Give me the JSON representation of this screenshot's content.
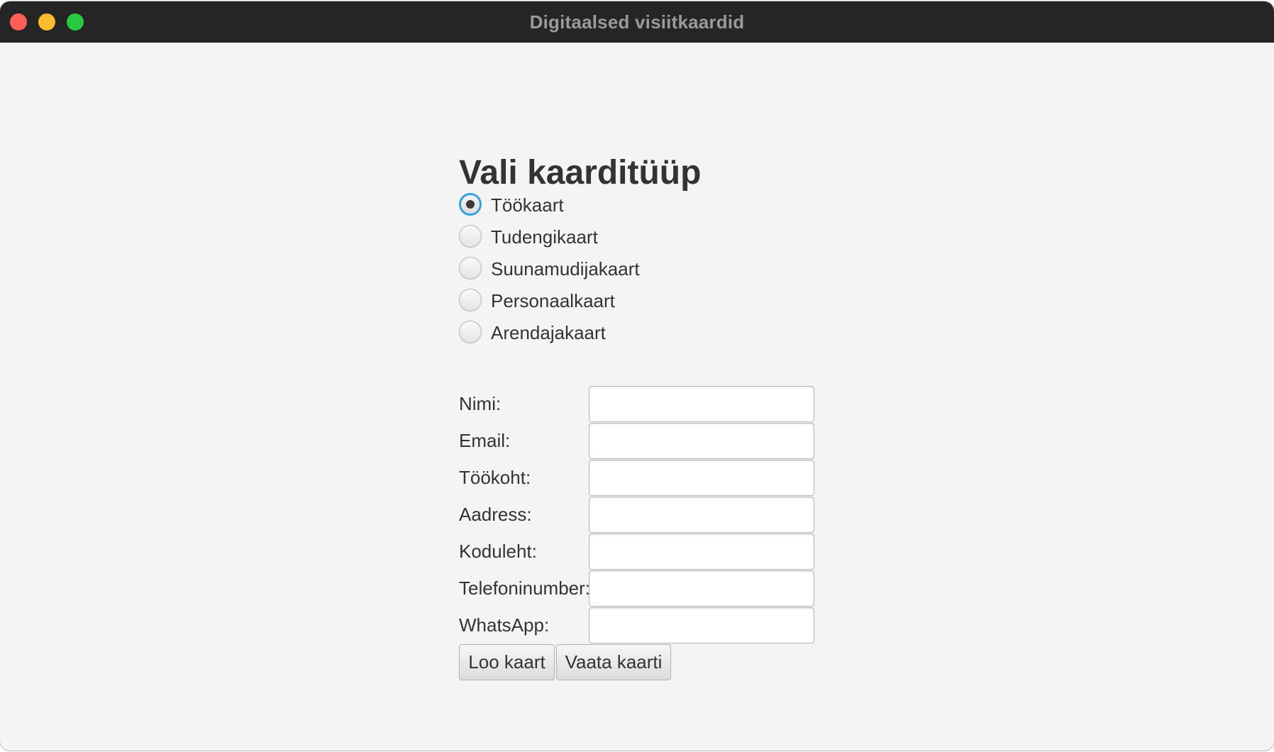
{
  "window": {
    "title": "Digitaalsed visiitkaardid"
  },
  "form": {
    "heading": "Vali kaarditüüp",
    "card_types": [
      {
        "label": "Töökaart",
        "selected": true
      },
      {
        "label": "Tudengikaart",
        "selected": false
      },
      {
        "label": "Suunamudijakaart",
        "selected": false
      },
      {
        "label": "Personaalkaart",
        "selected": false
      },
      {
        "label": "Arendajakaart",
        "selected": false
      }
    ],
    "fields": [
      {
        "label": "Nimi:",
        "value": ""
      },
      {
        "label": "Email:",
        "value": ""
      },
      {
        "label": "Töökoht:",
        "value": ""
      },
      {
        "label": "Aadress:",
        "value": ""
      },
      {
        "label": "Koduleht:",
        "value": ""
      },
      {
        "label": "Telefoninumber:",
        "value": ""
      },
      {
        "label": "WhatsApp:",
        "value": ""
      }
    ],
    "create_button_label": "Loo kaart",
    "view_button_label": "Vaata kaarti"
  },
  "colors": {
    "titlebar": "#252525",
    "window_background": "#f4f4f4",
    "radio_focus": "#36a2dc",
    "text": "#333333",
    "close": "#ff5f57",
    "minimize": "#febc2e",
    "zoom": "#28c840"
  }
}
